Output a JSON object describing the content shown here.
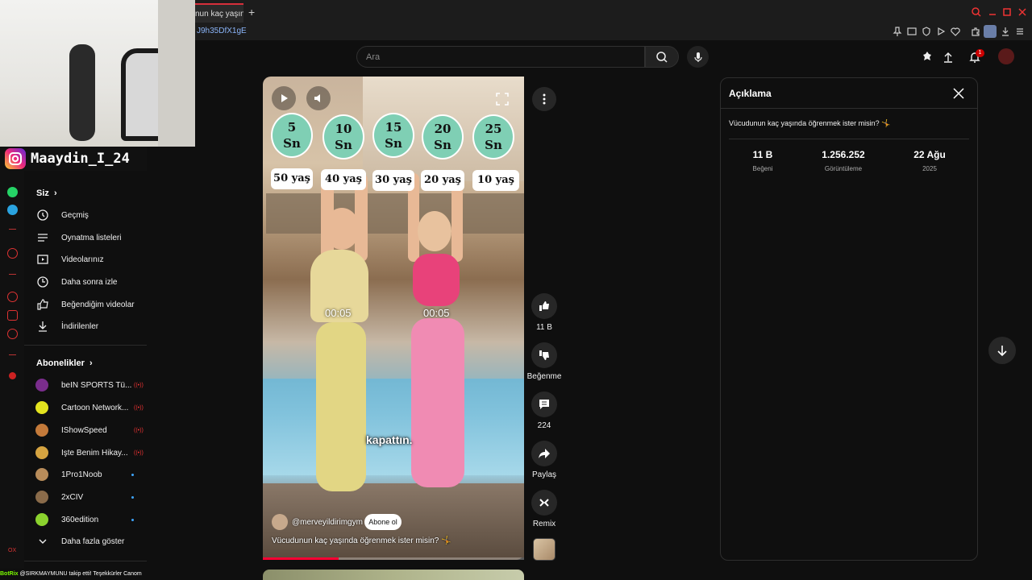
{
  "browser": {
    "tab_title": "nun kaç yaşında",
    "new_tab": "+",
    "url": "J9h35DfX1gE"
  },
  "overlay": {
    "instagram_handle": "Maaydin_I_24",
    "ticker_bot": "BotRix",
    "ticker_text": "@SIRKMAYMUNU takip etti! Teşekkürler Canom",
    "stream_label": "OX"
  },
  "header": {
    "search_placeholder": "Ara",
    "notification_count": "1"
  },
  "sidebar": {
    "you_title": "Siz",
    "you_items": [
      {
        "label": "Geçmiş",
        "icon": "history-icon"
      },
      {
        "label": "Oynatma listeleri",
        "icon": "playlist-icon"
      },
      {
        "label": "Videolarınız",
        "icon": "your-videos-icon"
      },
      {
        "label": "Daha sonra izle",
        "icon": "watch-later-icon"
      },
      {
        "label": "Beğendiğim videolar",
        "icon": "liked-icon"
      },
      {
        "label": "İndirilenler",
        "icon": "download-icon"
      }
    ],
    "subs_title": "Abonelikler",
    "subscriptions": [
      {
        "name": "beIN SPORTS Tü...",
        "color": "#7a2d8c",
        "status": "live"
      },
      {
        "name": "Cartoon Network...",
        "color": "#e4e41f",
        "status": "live"
      },
      {
        "name": "IShowSpeed",
        "color": "#c47a3a",
        "status": "live"
      },
      {
        "name": "İşte Benim Hikay...",
        "color": "#d6a441",
        "status": "live"
      },
      {
        "name": "1Pro1Noob",
        "color": "#b88c5a",
        "status": "new"
      },
      {
        "name": "2xCIV",
        "color": "#8a6b4a",
        "status": "new"
      },
      {
        "name": "360edition",
        "color": "#8bd22e",
        "status": "new"
      }
    ],
    "show_more": "Daha fazla göster"
  },
  "video": {
    "seconds": [
      "5\nSn",
      "10\nSn",
      "15\nSn",
      "20\nSn",
      "25\nSn"
    ],
    "ages": [
      "50 yaş",
      "40 yaş",
      "30 yaş",
      "20 yaş",
      "10 yaş"
    ],
    "timer_left": "00:05",
    "timer_right": "00:05",
    "subtitle": "kapattın.",
    "channel": "@merveyildirimgym",
    "subscribe": "Abone ol",
    "title": "Vücudunun kaç yaşında öğrenmek ister misin? 🤸",
    "progress": 0.29
  },
  "actions": {
    "like_count": "11 B",
    "dislike_label": "Beğenme",
    "comment_count": "224",
    "share_label": "Paylaş",
    "remix_label": "Remix"
  },
  "description": {
    "title": "Açıklama",
    "text": "Vücudunun kaç yaşında öğrenmek ister misin? 🤸",
    "likes_value": "11 B",
    "likes_label": "Beğeni",
    "views_value": "1.256.252",
    "views_label": "Görüntüleme",
    "date_value": "22 Ağu",
    "date_label": "2025"
  }
}
